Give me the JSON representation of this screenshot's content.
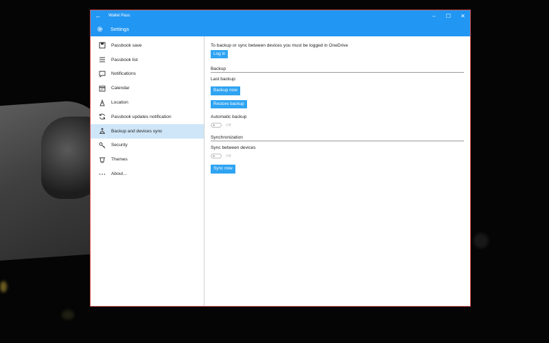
{
  "window": {
    "title": "Wallet Pass"
  },
  "titlebar": {
    "back_icon": "back-arrow-icon",
    "minimize": "–",
    "maximize": "☐",
    "close": "✕"
  },
  "appbar": {
    "title": "Settings",
    "icon": "gear-icon"
  },
  "sidebar": {
    "items": [
      {
        "label": "Passbook save",
        "icon": "save-icon"
      },
      {
        "label": "Passbook list",
        "icon": "list-icon"
      },
      {
        "label": "Notifications",
        "icon": "notification-icon"
      },
      {
        "label": "Calendar",
        "icon": "calendar-icon"
      },
      {
        "label": "Location",
        "icon": "location-icon"
      },
      {
        "label": "Passbook updates notification",
        "icon": "sync-icon"
      },
      {
        "label": "Backup and devices sync",
        "icon": "backup-icon",
        "selected": true
      },
      {
        "label": "Security",
        "icon": "key-icon"
      },
      {
        "label": "Themes",
        "icon": "themes-icon"
      },
      {
        "label": "About...",
        "icon": "more-icon"
      }
    ]
  },
  "main": {
    "intro": "To backup or sync between devices you must be logged in OneDrive",
    "login_label": "Log in",
    "backup": {
      "header": "Backup",
      "last_backup_label": "Last backup:",
      "backup_now_label": "Backup now",
      "restore_label": "Restore backup",
      "automatic_label": "Automatic backup",
      "automatic_state": "Off"
    },
    "sync": {
      "header": "Synchronization",
      "between_devices_label": "Sync between devices",
      "between_devices_state": "Off",
      "sync_now_label": "Sync now"
    }
  },
  "colors": {
    "accent": "#2196F3",
    "button": "#2ea3f2",
    "selected": "#cfe6f8"
  }
}
